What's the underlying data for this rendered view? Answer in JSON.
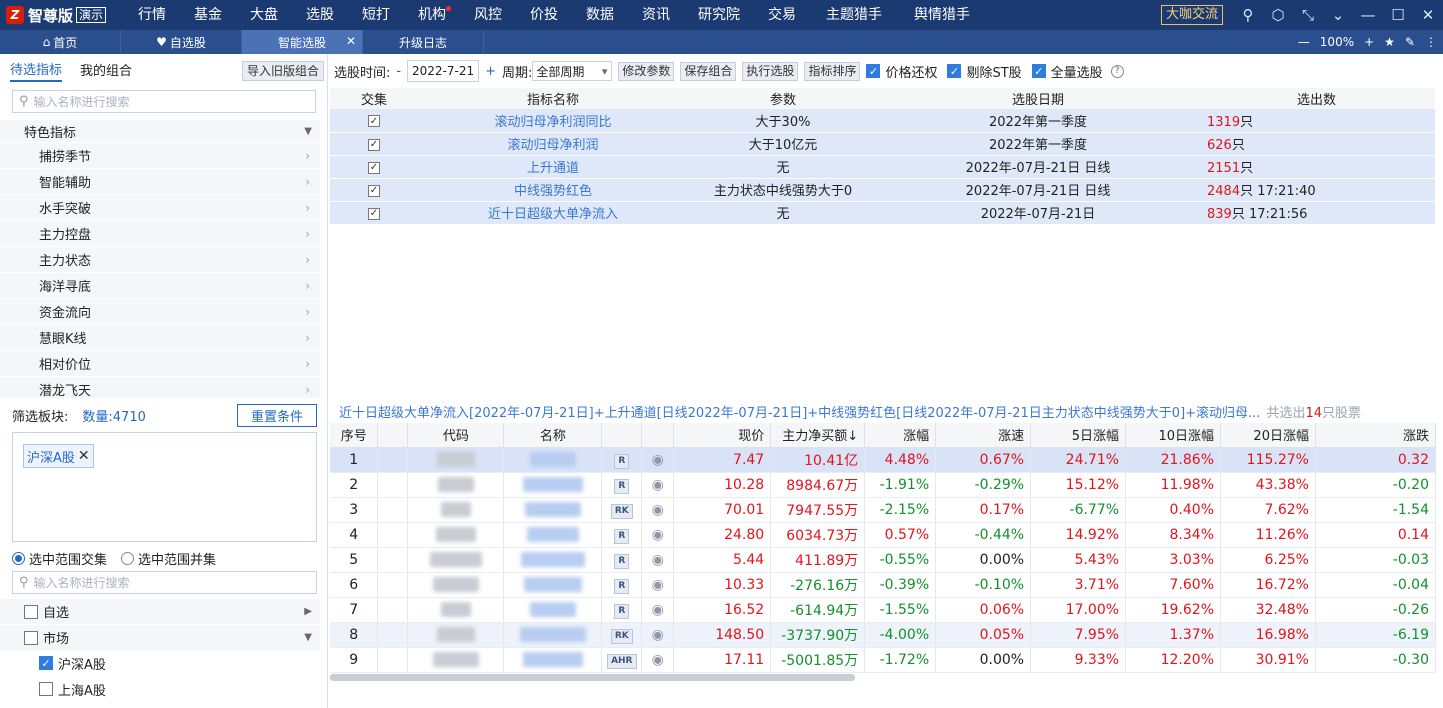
{
  "app": {
    "logo_text": "智尊版",
    "badge": "演示",
    "cafe": "大咖交流"
  },
  "menu": [
    "行情",
    "基金",
    "大盘",
    "选股",
    "短打",
    "机构",
    "风控",
    "价投",
    "数据",
    "资讯",
    "研究院",
    "交易",
    "主题猎手",
    "舆情猎手"
  ],
  "tabs": [
    {
      "label": "首页",
      "icon": "home-icon"
    },
    {
      "label": "自选股",
      "icon": "heart-icon"
    },
    {
      "label": "智能选股",
      "active": true
    },
    {
      "label": "升级日志"
    }
  ],
  "zoom": "100%",
  "left": {
    "subtabs": [
      "待选指标",
      "我的组合"
    ],
    "import_button": "导入旧版组合",
    "search_placeholder": "输入名称进行搜索",
    "category": "特色指标",
    "items": [
      "捕捞季节",
      "智能辅助",
      "水手突破",
      "主力控盘",
      "主力状态",
      "海洋寻底",
      "资金流向",
      "慧眼K线",
      "相对价位",
      "潜龙飞天"
    ],
    "filter_label": "筛选板块:",
    "count": "数量:4710",
    "reset": "重置条件",
    "chip": "沪深A股",
    "radio1": "选中范围交集",
    "radio2": "选中范围并集",
    "search2_placeholder": "输入名称进行搜索",
    "tree": {
      "fav": "自选",
      "market": "市场",
      "sub1": "沪深A股",
      "sub2": "上海A股"
    }
  },
  "toolbar": {
    "time_label": "选股时间:",
    "minus": "-",
    "date": "2022-7-21",
    "plus": "+",
    "period_label": "周期:",
    "period_value": "全部周期",
    "btn_modify": "修改参数",
    "btn_save": "保存组合",
    "btn_exec": "执行选股",
    "btn_sort": "指标排序",
    "chk_price": "价格还权",
    "chk_st": "剔除ST股",
    "chk_all": "全量选股"
  },
  "indicators": {
    "headers": [
      "交集",
      "指标名称",
      "参数",
      "选股日期",
      "选出数"
    ],
    "rows": [
      {
        "name": "滚动归母净利润同比",
        "param": "大于30%",
        "date": "2022年第一季度",
        "count": "1319",
        "unit": "只",
        "time": ""
      },
      {
        "name": "滚动归母净利润",
        "param": "大于10亿元",
        "date": "2022年第一季度",
        "count": "626",
        "unit": "只",
        "time": ""
      },
      {
        "name": "上升通道",
        "param": "无",
        "date": "2022年-07月-21日 日线",
        "count": "2151",
        "unit": "只",
        "time": ""
      },
      {
        "name": "中线强势红色",
        "param": "主力状态中线强势大于0",
        "date": "2022年-07月-21日 日线",
        "count": "2484",
        "unit": "只",
        "time": " 17:21:40"
      },
      {
        "name": "近十日超级大单净流入",
        "param": "无",
        "date": "2022年-07月-21日",
        "count": "839",
        "unit": "只",
        "time": " 17:21:56"
      }
    ]
  },
  "formula": {
    "text": "近十日超级大单净流入[2022年-07月-21日]+上升通道[日线2022年-07月-21日]+中线强势红色[日线2022年-07月-21日主力状态中线强势大于0]+滚动归母...",
    "total_prefix": "共选出",
    "total_count": "14",
    "total_suffix": "只股票"
  },
  "results": {
    "headers": [
      "序号",
      "代码",
      "名称",
      "",
      "",
      "现价",
      "主力净买额↓",
      "涨幅",
      "涨速",
      "5日涨幅",
      "10日涨幅",
      "20日涨幅",
      "涨跌"
    ],
    "rows": [
      {
        "no": "1",
        "tag": "R",
        "price": "7.47",
        "net": "10.41亿",
        "chg": "4.48%",
        "speed": "0.67%",
        "d5": "24.71%",
        "d10": "21.86%",
        "d20": "115.27%",
        "diff": "0.32"
      },
      {
        "no": "2",
        "tag": "R",
        "price": "10.28",
        "net": "8984.67万",
        "chg": "-1.91%",
        "speed": "-0.29%",
        "d5": "15.12%",
        "d10": "11.98%",
        "d20": "43.38%",
        "diff": "-0.20"
      },
      {
        "no": "3",
        "tag": "RK",
        "price": "70.01",
        "net": "7947.55万",
        "chg": "-2.15%",
        "speed": "0.17%",
        "d5": "-6.77%",
        "d10": "0.40%",
        "d20": "7.62%",
        "diff": "-1.54"
      },
      {
        "no": "4",
        "tag": "R",
        "price": "24.80",
        "net": "6034.73万",
        "chg": "0.57%",
        "speed": "-0.44%",
        "d5": "14.92%",
        "d10": "8.34%",
        "d20": "11.26%",
        "diff": "0.14"
      },
      {
        "no": "5",
        "tag": "R",
        "price": "5.44",
        "net": "411.89万",
        "chg": "-0.55%",
        "speed": "0.00%",
        "d5": "5.43%",
        "d10": "3.03%",
        "d20": "6.25%",
        "diff": "-0.03"
      },
      {
        "no": "6",
        "tag": "R",
        "price": "10.33",
        "net": "-276.16万",
        "chg": "-0.39%",
        "speed": "-0.10%",
        "d5": "3.71%",
        "d10": "7.60%",
        "d20": "16.72%",
        "diff": "-0.04"
      },
      {
        "no": "7",
        "tag": "R",
        "price": "16.52",
        "net": "-614.94万",
        "chg": "-1.55%",
        "speed": "0.06%",
        "d5": "17.00%",
        "d10": "19.62%",
        "d20": "32.48%",
        "diff": "-0.26"
      },
      {
        "no": "8",
        "tag": "RK",
        "price": "148.50",
        "net": "-3737.90万",
        "chg": "-4.00%",
        "speed": "0.05%",
        "d5": "7.95%",
        "d10": "1.37%",
        "d20": "16.98%",
        "diff": "-6.19"
      },
      {
        "no": "9",
        "tag": "AHR",
        "price": "17.11",
        "net": "-5001.85万",
        "chg": "-1.72%",
        "speed": "0.00%",
        "d5": "9.33%",
        "d10": "12.20%",
        "d20": "30.91%",
        "diff": "-0.30"
      }
    ]
  },
  "colors": {
    "up": "#e3141a",
    "down": "#12912b",
    "accent": "#2468c9",
    "topbar": "#1c3a72"
  }
}
